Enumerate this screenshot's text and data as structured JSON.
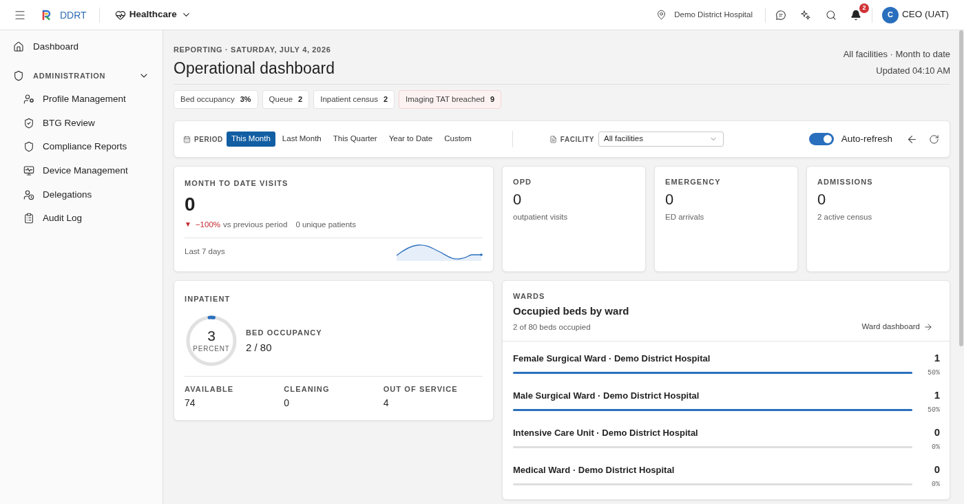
{
  "top_bar": {
    "brand": "DDRT",
    "module": "Healthcare",
    "facility": "Demo District Hospital",
    "notification_count": "2",
    "user": {
      "initial": "C",
      "name": "CEO (UAT)"
    }
  },
  "sidebar": {
    "items": [
      {
        "label": "Dashboard"
      }
    ],
    "sections": [
      {
        "label": "ADMINISTRATION",
        "expanded": true,
        "children": [
          {
            "label": "Profile Management"
          },
          {
            "label": "BTG Review"
          },
          {
            "label": "Compliance Reports"
          },
          {
            "label": "Device Management"
          },
          {
            "label": "Delegations"
          },
          {
            "label": "Audit Log"
          }
        ]
      }
    ]
  },
  "header": {
    "eyebrow": "REPORTING · SATURDAY, JULY 4, 2026",
    "title": "Operational dashboard",
    "scope": "All facilities · Month to date",
    "updated": "Updated 04:10 AM"
  },
  "summary_chips": [
    {
      "label": "Bed occupancy",
      "value": "3%",
      "alert": false
    },
    {
      "label": "Queue",
      "value": "2",
      "alert": false
    },
    {
      "label": "Inpatient census",
      "value": "2",
      "alert": false
    },
    {
      "label": "Imaging TAT breached",
      "value": "9",
      "alert": true
    }
  ],
  "filters": {
    "period_label": "PERIOD",
    "periods": [
      {
        "label": "This Month",
        "selected": true
      },
      {
        "label": "Last Month",
        "selected": false
      },
      {
        "label": "This Quarter",
        "selected": false
      },
      {
        "label": "Year to Date",
        "selected": false
      },
      {
        "label": "Custom",
        "selected": false
      }
    ],
    "facility_label": "FACILITY",
    "facility_value": "All facilities",
    "auto_refresh": {
      "label": "Auto-refresh",
      "on": true
    }
  },
  "visits_card": {
    "label": "MONTH TO DATE VISITS",
    "value": "0",
    "trend": {
      "arrow": "▼",
      "change": "−100%",
      "negative": true,
      "text": "vs previous period"
    },
    "unique_patients": "0 unique patients",
    "sparkline_label": "Last 7 days"
  },
  "stat_cards": [
    {
      "label": "OPD",
      "value": "0",
      "caption": "outpatient visits"
    },
    {
      "label": "EMERGENCY",
      "value": "0",
      "caption": "ED arrivals"
    },
    {
      "label": "ADMISSIONS",
      "value": "0",
      "caption": "2 active census"
    }
  ],
  "inpatient_card": {
    "label": "INPATIENT",
    "ring": {
      "value": "3",
      "unit": "PERCENT",
      "level": 0.03
    },
    "occupancy_label": "BED OCCUPANCY",
    "occupancy_value": "2 / 80",
    "stats": [
      {
        "label": "AVAILABLE",
        "value": "74"
      },
      {
        "label": "CLEANING",
        "value": "0"
      },
      {
        "label": "OUT OF SERVICE",
        "value": "4"
      }
    ]
  },
  "wards_card": {
    "label": "WARDS",
    "title": "Occupied beds by ward",
    "subtitle": "2 of 80 beds occupied",
    "link": "Ward dashboard",
    "rows": [
      {
        "name": "Female Surgical Ward · Demo District Hospital",
        "count": "1",
        "level": 1,
        "percent": "50%"
      },
      {
        "name": "Male Surgical Ward · Demo District Hospital",
        "count": "1",
        "level": 1,
        "percent": "50%"
      },
      {
        "name": "Intensive Care Unit · Demo District Hospital",
        "count": "0",
        "percent": "0%"
      },
      {
        "name": "Medical Ward · Demo District Hospital",
        "count": "0",
        "percent": "0%"
      }
    ]
  }
}
